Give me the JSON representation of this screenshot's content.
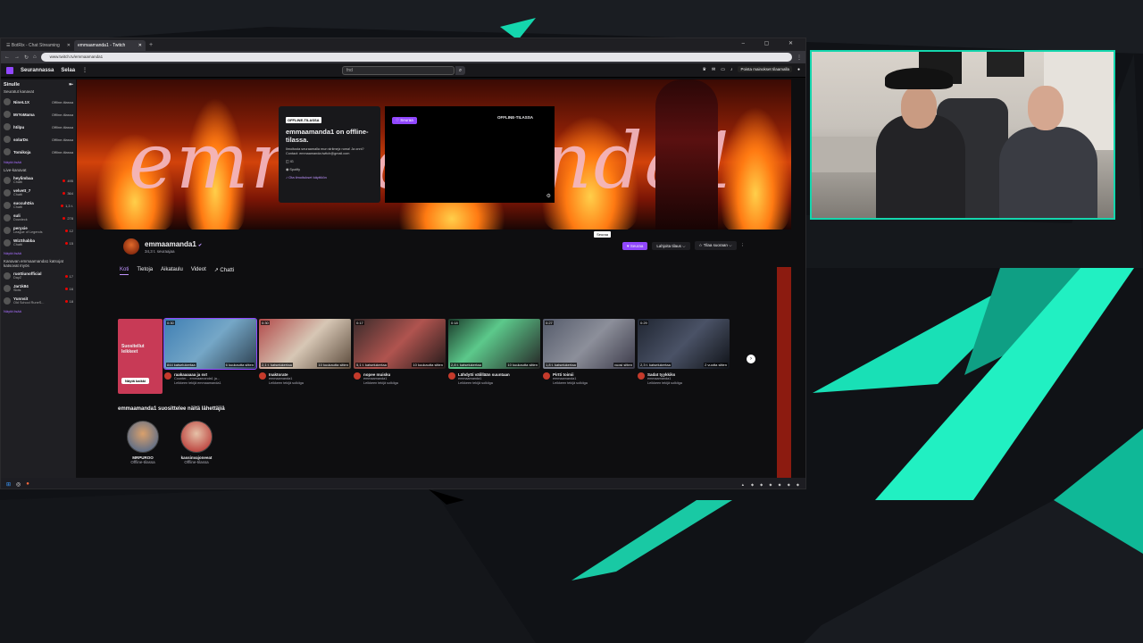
{
  "browser": {
    "tabs": [
      {
        "label": "☰ BotRix - Chat Streaming",
        "active": false
      },
      {
        "label": "emmaamanda1 - Twitch",
        "active": true
      }
    ],
    "url": "www.twitch.tv/emmaamanda1"
  },
  "twitch_nav": {
    "following": "Seurannassa",
    "browse": "Selaa",
    "search_value": "fnd",
    "promo": "Poista mainokset tilaamalla"
  },
  "sidebar": {
    "for_you": "Sinulle",
    "followed_title": "Seuratut kanavat",
    "followed": [
      {
        "name": "NineL1X",
        "status": "Offline-tilassa"
      },
      {
        "name": "MrYoMama",
        "status": "Offline-tilassa"
      },
      {
        "name": "htilpu",
        "status": "Offline-tilassa"
      },
      {
        "name": "solarDs",
        "status": "Offline-tilassa"
      },
      {
        "name": "Tomikoja",
        "status": "Offline-tilassa"
      }
    ],
    "show_more": "Näytä lisää",
    "live_title": "Live-kanavat",
    "live": [
      {
        "name": "heylimbaa",
        "game": "Chatti",
        "viewers": "495"
      },
      {
        "name": "velvett_7",
        "game": "Chatti",
        "viewers": "364"
      },
      {
        "name": "succuhDia",
        "game": "Chatti",
        "viewers": "1,3 t."
      },
      {
        "name": "suli",
        "game": "Dowdeck",
        "viewers": "278"
      },
      {
        "name": "peryxie",
        "game": "League of Legends",
        "viewers": "12"
      },
      {
        "name": "WizShabba",
        "game": "Chatti",
        "viewers": "15"
      }
    ],
    "show_more2": "Näytä lisää",
    "rec_title": "Kanavan emmaamanda1 katsojat katsovat myös",
    "rec": [
      {
        "name": "ruottiunofficial",
        "game": "DayZ",
        "viewers": "17"
      },
      {
        "name": "Jar1k84",
        "game": "Slots",
        "viewers": "16"
      },
      {
        "name": "Yunnsit",
        "game": "Old School RuneS...",
        "viewers": "18"
      }
    ],
    "show_more3": "Näytä lisää"
  },
  "offline_card": {
    "badge": "OFFLINE-TILASSA",
    "title": "emmaamanda1 on offline-tilassa.",
    "desc": "Ilmoitusta seuraamalla mun striimejz ruma! Ja onni? Contact: emmaamanda.twitch@gmail.com",
    "meta1": "IG",
    "meta2": "Spotify",
    "link": "Ota ilmoitukset käyttöön"
  },
  "player": {
    "follow": "♡ Seuraa",
    "offline_label": "OFFLINE-TILASSA"
  },
  "channel": {
    "name": "emmaamanda1",
    "followers": "34,3 t. seuraajaa",
    "tabs": [
      "Koti",
      "Tietoja",
      "Aikataulu",
      "Videot",
      "↗ Chatti"
    ],
    "follow_btn": "♥ Seuraa",
    "gift_btn": "Lahjoita tilaus ⌵",
    "sub_btn": "☆ Tilaa suoraan ⌵",
    "tooltip": "Seuraa",
    "more": "⋮"
  },
  "clips": {
    "intro_title": "Suositellut leikkeet",
    "intro_btn": "Näytä kaikki",
    "items": [
      {
        "dur": "0:30",
        "views": "844 katselukertaa",
        "ago": "6 kuukautta sitten",
        "title": "raakaaaaaa ja svt",
        "sub": "Counter... emmaamanda1 ja...",
        "sub2": "Leikkeen tekijä emmaamanda1"
      },
      {
        "dur": "0:30",
        "views": "2,1 t. katselukertaa",
        "ago": "10 kuukautta sitten",
        "title": "Inaktorate",
        "sub": "emmaamanda1",
        "sub2": "Leikkeen tekijä solkiiga"
      },
      {
        "dur": "0:17",
        "views": "5,1 t. katselukertaa",
        "ago": "10 kuukautta sitten",
        "title": "nopee muisku",
        "sub": "emmaamanda1",
        "sub2": "Leikkeen tekijä solkiiga"
      },
      {
        "dur": "0:18",
        "views": "2,8 t. katselukertaa",
        "ago": "10 kuukautta sitten",
        "title": "Lähdytti välillään suuntaan",
        "sub": "emmaamanda1",
        "sub2": "Leikkeen tekijä solkiiga"
      },
      {
        "dur": "0:27",
        "views": "1,8 t. katselukertaa",
        "ago": "vuosi sitten",
        "title": "Pirtti toimii",
        "sub": "emmaamanda1",
        "sub2": "Leikkeen tekijä solkiiga"
      },
      {
        "dur": "0:29",
        "views": "2,3 t. katselukertaa",
        "ago": "2 vuotta sitten",
        "title": "Sadat tyykkiks",
        "sub": "emmaamanda1",
        "sub2": "Leikkeen tekijä solkiiga"
      }
    ]
  },
  "recommended": {
    "title": "emmaamanda1 suosittelee näitä lähettäjiä",
    "items": [
      {
        "name": "MRPUROO",
        "status": "Offline-tilassa"
      },
      {
        "name": "kassinvajoneeat",
        "status": "Offline-tilassa"
      }
    ]
  },
  "colors": {
    "accent": "#9147ff",
    "cam_border": "#14d6ad"
  }
}
